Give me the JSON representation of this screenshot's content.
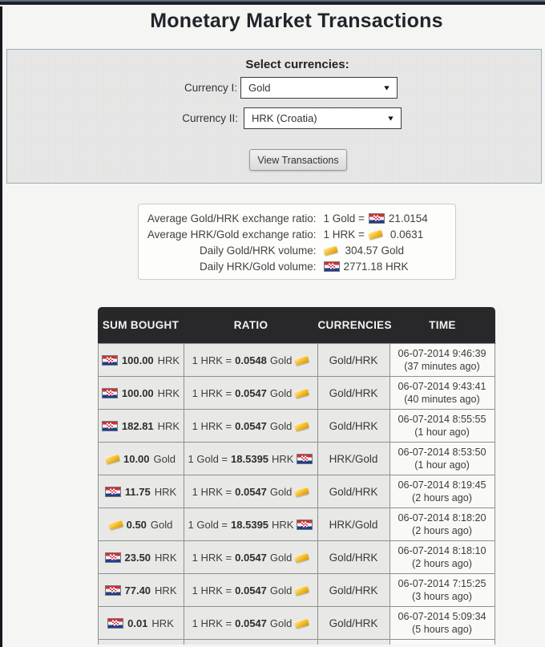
{
  "page": {
    "title": "Monetary Market Transactions"
  },
  "currency_panel": {
    "heading": "Select currencies:",
    "fields": [
      {
        "label": "Currency I:",
        "value": "Gold"
      },
      {
        "label": "Currency II:",
        "value": "HRK (Croatia)"
      }
    ],
    "view_button_label": "View Transactions"
  },
  "stats": {
    "rows": [
      {
        "label": "Average Gold/HRK exchange ratio:",
        "prefix": "1 Gold =",
        "icon": "croatia-flag",
        "value": "21.0154"
      },
      {
        "label": "Average HRK/Gold exchange ratio:",
        "prefix": "1 HRK =",
        "icon": "gold-bar",
        "value": "0.0631"
      },
      {
        "label": "Daily Gold/HRK volume:",
        "prefix": "",
        "icon": "gold-bar",
        "value": "304.57 Gold"
      },
      {
        "label": "Daily HRK/Gold volume:",
        "prefix": "",
        "icon": "croatia-flag",
        "value": "2771.18 HRK"
      }
    ]
  },
  "table": {
    "headers": [
      "SUM BOUGHT",
      "RATIO",
      "CURRENCIES",
      "TIME"
    ],
    "rows": [
      {
        "sum_icon": "croatia-flag",
        "sum_amount": "100.00",
        "sum_unit": "HRK",
        "ratio_prefix": "1 HRK =",
        "ratio_value": "0.0548",
        "ratio_unit": "Gold",
        "ratio_icon": "gold-bar",
        "currencies": "Gold/HRK",
        "time_date": "06-07-2014 9:46:39",
        "time_ago": "(37 minutes ago)"
      },
      {
        "sum_icon": "croatia-flag",
        "sum_amount": "100.00",
        "sum_unit": "HRK",
        "ratio_prefix": "1 HRK =",
        "ratio_value": "0.0547",
        "ratio_unit": "Gold",
        "ratio_icon": "gold-bar",
        "currencies": "Gold/HRK",
        "time_date": "06-07-2014 9:43:41",
        "time_ago": "(40 minutes ago)"
      },
      {
        "sum_icon": "croatia-flag",
        "sum_amount": "182.81",
        "sum_unit": "HRK",
        "ratio_prefix": "1 HRK =",
        "ratio_value": "0.0547",
        "ratio_unit": "Gold",
        "ratio_icon": "gold-bar",
        "currencies": "Gold/HRK",
        "time_date": "06-07-2014 8:55:55",
        "time_ago": "(1 hour ago)"
      },
      {
        "sum_icon": "gold-bar",
        "sum_amount": "10.00",
        "sum_unit": "Gold",
        "ratio_prefix": "1 Gold =",
        "ratio_value": "18.5395",
        "ratio_unit": "HRK",
        "ratio_icon": "croatia-flag",
        "currencies": "HRK/Gold",
        "time_date": "06-07-2014 8:53:50",
        "time_ago": "(1 hour ago)"
      },
      {
        "sum_icon": "croatia-flag",
        "sum_amount": "11.75",
        "sum_unit": "HRK",
        "ratio_prefix": "1 HRK =",
        "ratio_value": "0.0547",
        "ratio_unit": "Gold",
        "ratio_icon": "gold-bar",
        "currencies": "Gold/HRK",
        "time_date": "06-07-2014 8:19:45",
        "time_ago": "(2 hours ago)"
      },
      {
        "sum_icon": "gold-bar",
        "sum_amount": "0.50",
        "sum_unit": "Gold",
        "ratio_prefix": "1 Gold =",
        "ratio_value": "18.5395",
        "ratio_unit": "HRK",
        "ratio_icon": "croatia-flag",
        "currencies": "HRK/Gold",
        "time_date": "06-07-2014 8:18:20",
        "time_ago": "(2 hours ago)"
      },
      {
        "sum_icon": "croatia-flag",
        "sum_amount": "23.50",
        "sum_unit": "HRK",
        "ratio_prefix": "1 HRK =",
        "ratio_value": "0.0547",
        "ratio_unit": "Gold",
        "ratio_icon": "gold-bar",
        "currencies": "Gold/HRK",
        "time_date": "06-07-2014 8:18:10",
        "time_ago": "(2 hours ago)"
      },
      {
        "sum_icon": "croatia-flag",
        "sum_amount": "77.40",
        "sum_unit": "HRK",
        "ratio_prefix": "1 HRK =",
        "ratio_value": "0.0547",
        "ratio_unit": "Gold",
        "ratio_icon": "gold-bar",
        "currencies": "Gold/HRK",
        "time_date": "06-07-2014 7:15:25",
        "time_ago": "(3 hours ago)"
      },
      {
        "sum_icon": "croatia-flag",
        "sum_amount": "0.01",
        "sum_unit": "HRK",
        "ratio_prefix": "1 HRK =",
        "ratio_value": "0.0547",
        "ratio_unit": "Gold",
        "ratio_icon": "gold-bar",
        "currencies": "Gold/HRK",
        "time_date": "06-07-2014 5:09:34",
        "time_ago": "(5 hours ago)"
      }
    ]
  },
  "icons": {
    "dropdown_arrow": "▼",
    "croatia-flag": "red-white-blue flag with checkered shield",
    "gold-bar": "gold ingot"
  },
  "colors": {
    "table_header_bg": "#28282a",
    "panel_border": "#9ab0bd",
    "gold": "#f3bb2a",
    "flag_red": "#cf3039",
    "flag_blue": "#1c3e8f"
  }
}
